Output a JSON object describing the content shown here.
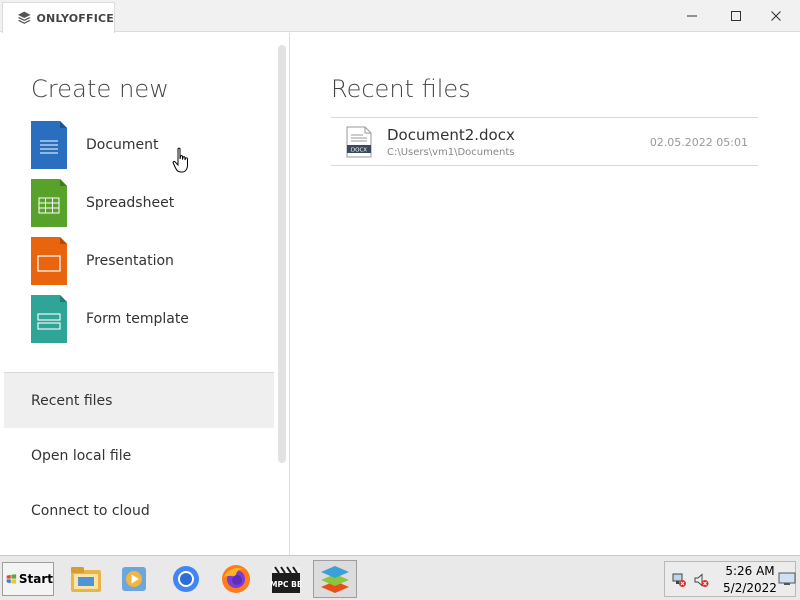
{
  "window": {
    "tab_label": "ONLYOFFICE",
    "logo_icon": "onlyoffice-layers-icon",
    "controls": {
      "minimize": "─",
      "maximize": "☐",
      "close": "✕"
    }
  },
  "sidebar": {
    "create_title": "Create new",
    "create_items": [
      {
        "label": "Document",
        "icon": "document-icon",
        "color": "#2a6fbf"
      },
      {
        "label": "Spreadsheet",
        "icon": "spreadsheet-icon",
        "color": "#58a12b"
      },
      {
        "label": "Presentation",
        "icon": "presentation-icon",
        "color": "#e06010"
      },
      {
        "label": "Form template",
        "icon": "form-template-icon",
        "color": "#2fa597"
      }
    ],
    "nav_items": [
      {
        "label": "Recent files",
        "active": true
      },
      {
        "label": "Open local file",
        "active": false
      },
      {
        "label": "Connect to cloud",
        "active": false
      }
    ]
  },
  "main": {
    "recent_title": "Recent files",
    "files": [
      {
        "name": "Document2.docx",
        "path": "C:\\Users\\vm1\\Documents",
        "date": "02.05.2022 05:01",
        "type_badge": "DOCX"
      }
    ]
  },
  "taskbar": {
    "start_label": "Start",
    "time": "5:26 AM",
    "date": "5/2/2022",
    "pinned": [
      "file-explorer-icon",
      "media-player-icon",
      "chrome-icon",
      "firefox-icon",
      "mpc-be-icon",
      "onlyoffice-icon"
    ],
    "mpc_label": "MPC BE"
  }
}
